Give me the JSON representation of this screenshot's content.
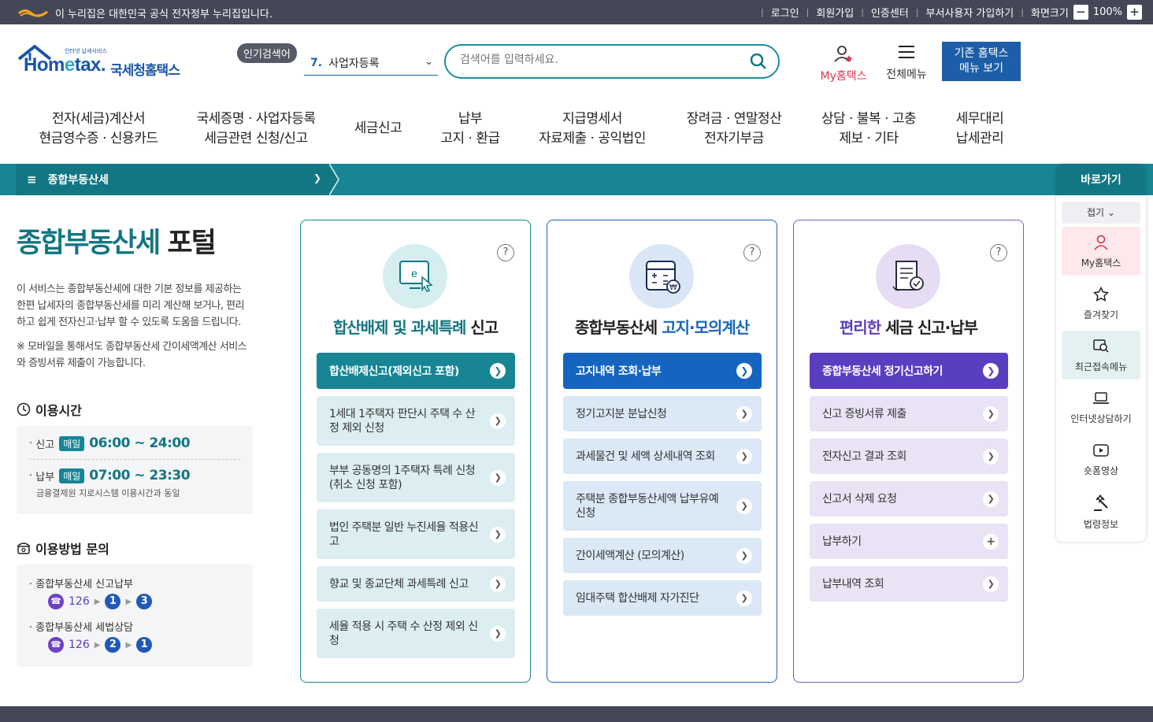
{
  "topbar": {
    "gov_notice": "이 누리집은 대한민국 공식 전자정부 누리집입니다.",
    "links": [
      "로그인",
      "회원가입",
      "인증센터",
      "부서사용자 가입하기",
      "화면크기"
    ],
    "zoom": "100%",
    "zoom_minus": "−",
    "zoom_plus": "+"
  },
  "header": {
    "logo_small": "인터넷 납세서비스",
    "logo_text_h": "Hom",
    "logo_text_e": "e",
    "logo_text_tax": "tax.",
    "logo_kr": "국세청홈택스",
    "popular_label": "인기검색어",
    "popular_num": "7.",
    "popular_keyword": "사업자등록",
    "search_placeholder": "검색어를 입력하세요.",
    "my_hometax": "My홈택스",
    "all_menu": "전체메뉴",
    "old_hometax_1": "기존 홈택스",
    "old_hometax_2": "메뉴 보기"
  },
  "gnb": [
    {
      "l1": "전자(세금)계산서",
      "l2": "현금영수증 · 신용카드"
    },
    {
      "l1": "국세증명 · 사업자등록",
      "l2": "세금관련 신청/신고"
    },
    {
      "l1": "세금신고",
      "l2": ""
    },
    {
      "l1": "납부",
      "l2": "고지 · 환급"
    },
    {
      "l1": "지급명세서",
      "l2": "자료제출 · 공익법인"
    },
    {
      "l1": "장려금 · 연말정산",
      "l2": "전자기부금"
    },
    {
      "l1": "상담 · 불복 · 고충",
      "l2": "제보 · 기타"
    },
    {
      "l1": "세무대리",
      "l2": "납세관리"
    }
  ],
  "subbar": {
    "current": "종합부동산세"
  },
  "left": {
    "title_colored": "종합부동산세",
    "title_plain": " 포털",
    "desc": "이 서비스는 종합부동산세에 대한 기본 정보를 제공하는 한편 납세자의 종합부동산세를 미리 계산해 보거나, 편리하고 쉽게 전자신고·납부 할 수 있도록 도움을 드립니다.",
    "note": "※ 모바일을 통해서도 종합부동산세 간이세액계산 서비스와 증빙서류 제출이 가능합니다.",
    "hours_title": "이용시간",
    "hours": [
      {
        "label": "신고",
        "badge": "매일",
        "time": "06:00 ~ 24:00",
        "sub": ""
      },
      {
        "label": "납부",
        "badge": "매일",
        "time": "07:00 ~ 23:30",
        "sub": "금융결제원 지로시스템 이용시간과 동일"
      }
    ],
    "inquiry_title": "이용방법 문의",
    "inquiries": [
      {
        "label": "종합부동산세 신고납부",
        "phone": "126",
        "n1": "1",
        "n2": "3"
      },
      {
        "label": "종합부동산세 세법상담",
        "phone": "126",
        "n1": "2",
        "n2": "1"
      }
    ]
  },
  "cards": [
    {
      "title_hl": "합산배제 및 과세특례",
      "title_rest": " 신고",
      "main": "합산배제신고(제외신고 포함)",
      "subs": [
        "1세대 1주택자 판단시 주택 수 산정 제외 신청",
        "부부 공동명의 1주택자 특례 신청(취소 신청 포함)",
        "법인 주택분 일반 누진세율 적용신고",
        "향교 및 종교단체 과세특례 신고",
        "세율 적용 시 주택 수 산정 제외 신청"
      ]
    },
    {
      "title_rest0": "종합부동산세 ",
      "title_hl": "고지·모의계산",
      "main": "고지내역 조회·납부",
      "subs": [
        "정기고지분 분납신청",
        "과세물건 및 세액 상세내역 조회",
        "주택분 종합부동산세액 납부유예 신청",
        "간이세액계산 (모의계산)",
        "임대주택 합산배제 자가진단"
      ]
    },
    {
      "title_hl": "편리한",
      "title_rest": " 세금 신고·납부",
      "main": "종합부동산세 정기신고하기",
      "subs": [
        "신고 증빙서류 제출",
        "전자신고 결과 조회",
        "신고서 삭제 요청",
        "납부하기",
        "납부내역 조회"
      ]
    }
  ],
  "quick": {
    "title": "바로가기",
    "fold": "접기",
    "items": [
      "My홈택스",
      "즐겨찾기",
      "최근접속메뉴",
      "인터넷상담하기",
      "숏폼영상",
      "법령정보"
    ]
  },
  "colors": {
    "teal": "#178594",
    "blue": "#1565c0",
    "purple": "#5a3ec0",
    "dark": "#454757"
  }
}
